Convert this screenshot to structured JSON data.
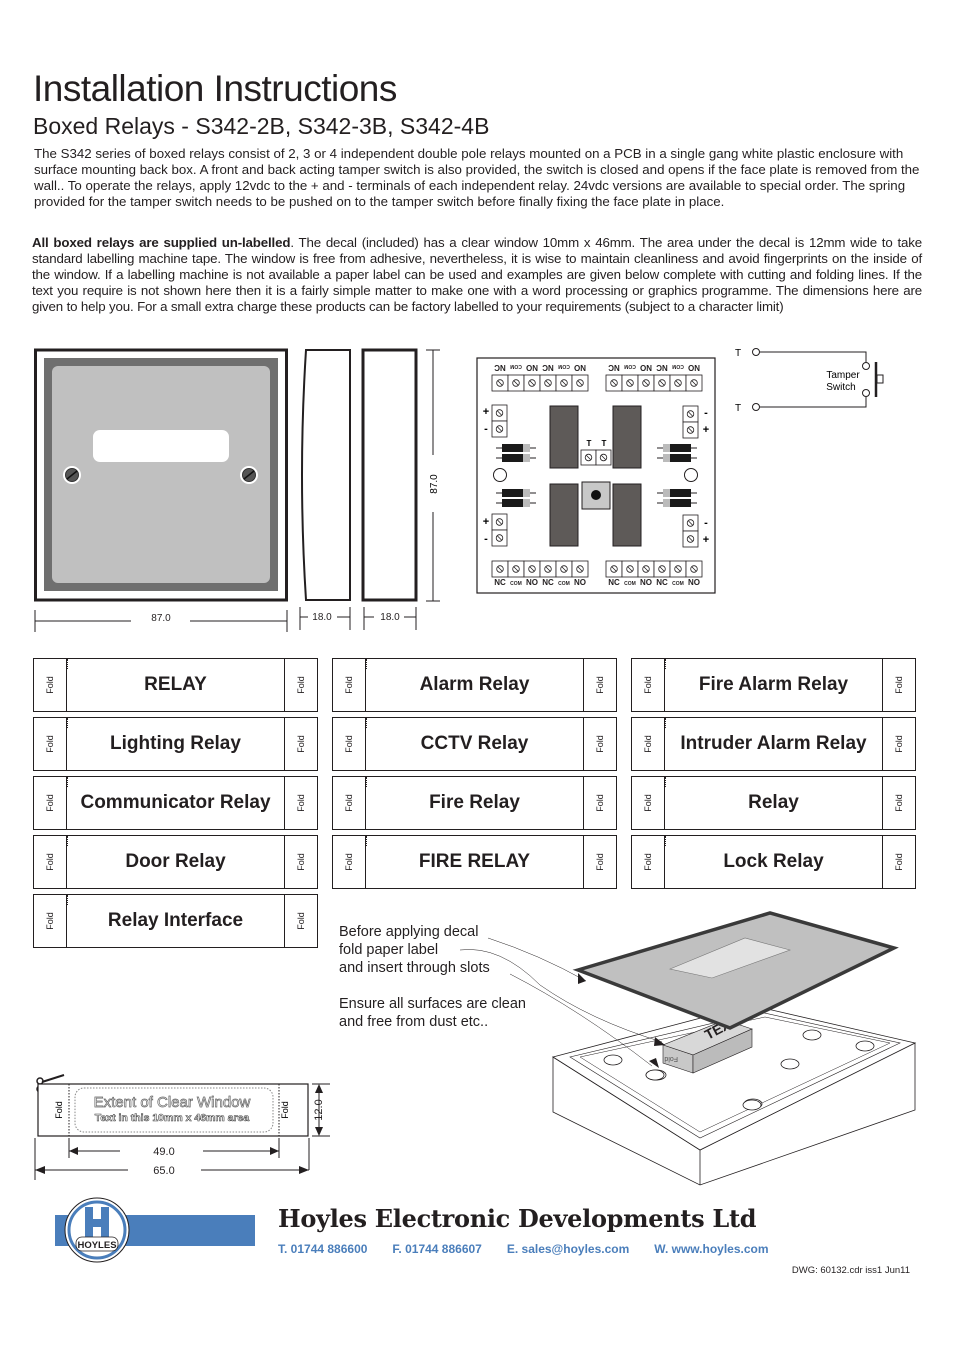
{
  "header": {
    "title": "Installation Instructions",
    "subtitle": "Boxed Relays - S342-2B, S342-3B, S342-4B"
  },
  "intro": {
    "paragraph1": "The S342 series of boxed relays  consist of 2, 3 or 4 independent double pole relays mounted on a PCB in a single gang white plastic enclosure with surface mounting back box. A front and back acting tamper switch is also provided, the switch is closed and opens if the face plate is removed from the wall.. To operate the relays, apply 12vdc to the + and - terminals of each independent relay. 24vdc versions are available to special order. The spring provided for the tamper switch needs to be pushed on to the tamper switch before finally fixing the face plate in place.",
    "paragraph2_bold": "All boxed relays are supplied un-labelled",
    "paragraph2_rest": ". The decal (included) has a clear window 10mm x 46mm. The  area under the decal is 12mm wide to take standard labelling machine tape. The window is free from adhesive, nevertheless, it is wise to maintain cleanliness and avoid fingerprints on the inside of the window. If a labelling machine is not available a paper label can be used and examples are given below complete with cutting and folding lines. If the text you require is not shown here then it is a fairly simple matter to make one with a word processing or graphics programme. The dimensions here are given to help you. For a small extra charge these products can be factory labelled to your requirements (subject  to a character limit)"
  },
  "dimensions": {
    "front_width": "87.0",
    "side_depth_1": "18.0",
    "side_depth_2": "18.0",
    "height": "87.0"
  },
  "pcb": {
    "top_terminals_left": [
      "NC",
      "COM",
      "NO",
      "NC",
      "COM",
      "NO"
    ],
    "top_terminals_right": [
      "NC",
      "COM",
      "NO",
      "NC",
      "COM",
      "NO"
    ],
    "bottom_terminals_left": [
      "NC",
      "COM",
      "NO",
      "NC",
      "COM",
      "NO"
    ],
    "bottom_terminals_right": [
      "NC",
      "COM",
      "NO",
      "NC",
      "COM",
      "NO"
    ],
    "tamper_terminals": [
      "T",
      "T"
    ],
    "plus": "+",
    "minus": "-"
  },
  "tamper": {
    "t1": "T",
    "t2": "T",
    "label_line1": "Tamper",
    "label_line2": "Switch"
  },
  "labels": {
    "fold_text": "Fold",
    "items": [
      "RELAY",
      "Alarm Relay",
      "Fire Alarm Relay",
      "Lighting Relay",
      "CCTV Relay",
      "Intruder Alarm Relay",
      "Communicator Relay",
      "Fire Relay",
      "Relay",
      "Door Relay",
      "FIRE RELAY",
      "Lock Relay",
      "Relay Interface"
    ]
  },
  "label_template": {
    "line1": "Extent of Clear Window",
    "line2": "Text in this 10mm x 46mm area",
    "fold": "Fold",
    "height_dim": "12.0",
    "inner_width_dim": "49.0",
    "outer_width_dim": "65.0"
  },
  "assembly": {
    "note1_line1": "Before applying decal",
    "note1_line2": "fold paper label",
    "note1_line3": "and insert through slots",
    "note2_line1": "Ensure all surfaces are clean",
    "note2_line2": "and free from dust etc..",
    "label_text": "TEXT",
    "fold_text": "Fold"
  },
  "footer": {
    "logo_text": "HOYLES",
    "company": "Hoyles Electronic Developments Ltd",
    "phone": "T. 01744 886600",
    "fax": "F. 01744 886607",
    "email": "E. sales@hoyles.com",
    "web": "W. www.hoyles.com",
    "dwg": "DWG: 60132.cdr iss1 Jun11",
    "brand_color": "#4a7ebb"
  }
}
